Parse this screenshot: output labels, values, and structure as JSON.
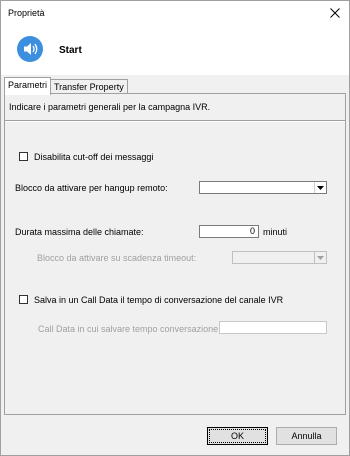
{
  "window": {
    "title": "Proprietà"
  },
  "header": {
    "icon": "speaker-icon",
    "title": "Start"
  },
  "tabs": [
    {
      "label": "Parametri",
      "active": true
    },
    {
      "label": "Transfer Property",
      "active": false
    }
  ],
  "panel": {
    "intro": "Indicare i parametri generali per la campagna IVR.",
    "disable_cutoff": {
      "label": "Disabilita cut-off dei messaggi",
      "checked": false
    },
    "hangup_block": {
      "label": "Blocco da attivare per hangup remoto:",
      "value": ""
    },
    "max_duration": {
      "label": "Durata massima delle chiamate:",
      "value": "0",
      "unit": "minuti"
    },
    "timeout_block": {
      "label": "Blocco da attivare su scadenza timeout:",
      "value": "",
      "enabled": false
    },
    "save_call_data": {
      "label": "Salva in un Call Data il tempo di conversazione del canale IVR",
      "checked": false
    },
    "call_data_field": {
      "label": "Call Data in cui salvare tempo conversazione:",
      "value": "",
      "enabled": false
    }
  },
  "footer": {
    "ok_label": "OK",
    "cancel_label": "Annulla"
  },
  "colors": {
    "accent": "#3c8fde",
    "border": "#a0a0a0",
    "disabled_text": "#a0a0a0"
  }
}
